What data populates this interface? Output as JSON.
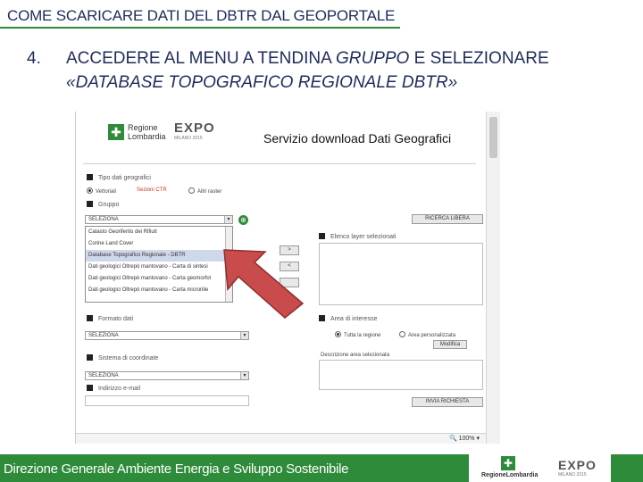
{
  "slide": {
    "title": "COME SCARICARE DATI DEL DBTR DAL GEOPORTALE",
    "step_number": "4.",
    "step_line1_a": "ACCEDERE AL MENU A TENDINA ",
    "step_line1_b": "GRUPPO",
    "step_line1_c": " E SELEZIONARE",
    "step_line2": "«DATABASE TOPOGRAFICO REGIONALE DBTR»",
    "footer_text": "Direzione Generale Ambiente Energia e Sviluppo Sostenibile",
    "footer_logo_text": "RegioneLombardia",
    "footer_expo": "EXPO",
    "footer_expo_sub": "MILANO 2015"
  },
  "app": {
    "logo_text": "Regione\nLombardia",
    "expo": "EXPO",
    "expo_sub": "MILANO 2015",
    "service_title": "Servizio download Dati Geografici",
    "tipo_dati_label": "Tipo dati geografici",
    "opt_vettoriali": "Vettoriali",
    "opt_sezioni_ctr": "Sezioni CTR",
    "opt_altri_raster": "Altri raster",
    "gruppo_label": "Gruppo",
    "gruppo_value": "SELEZIONA",
    "dropdown_items": [
      "Catasto Georiferito dei Rifiuti",
      "Corine Land Cover",
      "Database Topografico Regionale - DBTR",
      "Dati geologici Oltrepò mantovano - Carta di sintesi",
      "Dati geologici Oltrepò mantovano - Carta geomorfol",
      "Dati geologici Oltrepò mantovano - Carta microrilie"
    ],
    "ricerca_libera": "RICERCA LIBERA",
    "elenco_layer": "Elenco layer selezionati",
    "move_right": ">",
    "move_left": "<",
    "formato_label": "Formato dati",
    "formato_value": "SELEZIONA",
    "area_label": "Area di interesse",
    "opt_tutta": "Tutta la regione",
    "opt_personalizzata": "Area personalizzata",
    "modifica": "Modifica",
    "descrizione_area": "Descrizione area selezionata",
    "sistema_label": "Sistema di coordinate",
    "sistema_value": "SELEZIONA",
    "email_label": "Indirizzo e-mail",
    "invia": "INVIA RICHIESTA",
    "zoom": "100%"
  },
  "colors": {
    "accent_green": "#2e8b3a",
    "title_blue": "#1f2b5a",
    "arrow_red": "#c94b4b"
  }
}
